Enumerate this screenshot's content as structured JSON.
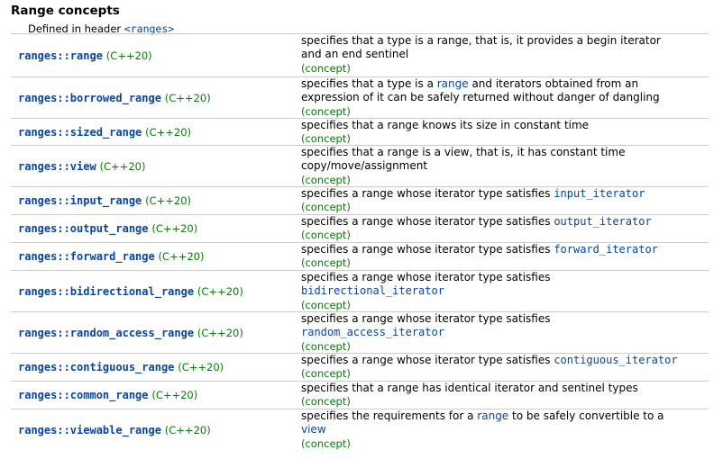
{
  "heading": "Range concepts",
  "defined_prefix": "Defined in header ",
  "header_name": "<ranges>",
  "concept_label": "(concept)",
  "rows": [
    {
      "name": "ranges::range",
      "std": "(C++20)",
      "lines": [
        [
          {
            "t": "text",
            "v": "specifies that a type is a range, that is, it provides a begin iterator"
          }
        ],
        [
          {
            "t": "text",
            "v": "and an end sentinel"
          }
        ]
      ]
    },
    {
      "name": "ranges::borrowed_range",
      "std": "(C++20)",
      "lines": [
        [
          {
            "t": "text",
            "v": "specifies that a type is a "
          },
          {
            "t": "link",
            "v": "range"
          },
          {
            "t": "text",
            "v": " and iterators obtained from an"
          }
        ],
        [
          {
            "t": "text",
            "v": "expression of it can be safely returned without danger of dangling"
          }
        ]
      ]
    },
    {
      "name": "ranges::sized_range",
      "std": "(C++20)",
      "lines": [
        [
          {
            "t": "text",
            "v": "specifies that a range knows its size in constant time"
          }
        ]
      ]
    },
    {
      "name": "ranges::view",
      "std": "(C++20)",
      "lines": [
        [
          {
            "t": "text",
            "v": "specifies that a range is a view, that is, it has constant time"
          }
        ],
        [
          {
            "t": "text",
            "v": "copy/move/assignment"
          }
        ]
      ]
    },
    {
      "name": "ranges::input_range",
      "std": "(C++20)",
      "lines": [
        [
          {
            "t": "text",
            "v": "specifies a range whose iterator type satisfies "
          },
          {
            "t": "code",
            "v": "input_iterator"
          }
        ]
      ]
    },
    {
      "name": "ranges::output_range",
      "std": "(C++20)",
      "lines": [
        [
          {
            "t": "text",
            "v": "specifies a range whose iterator type satisfies "
          },
          {
            "t": "code",
            "v": "output_iterator"
          }
        ]
      ]
    },
    {
      "name": "ranges::forward_range",
      "std": "(C++20)",
      "lines": [
        [
          {
            "t": "text",
            "v": "specifies a range whose iterator type satisfies "
          },
          {
            "t": "code",
            "v": "forward_iterator"
          }
        ]
      ]
    },
    {
      "name": "ranges::bidirectional_range",
      "std": "(C++20)",
      "lines": [
        [
          {
            "t": "text",
            "v": "specifies a range whose iterator type satisfies"
          }
        ],
        [
          {
            "t": "code",
            "v": "bidirectional_iterator"
          }
        ]
      ]
    },
    {
      "name": "ranges::random_access_range",
      "std": "(C++20)",
      "lines": [
        [
          {
            "t": "text",
            "v": "specifies a range whose iterator type satisfies"
          }
        ],
        [
          {
            "t": "code",
            "v": "random_access_iterator"
          }
        ]
      ]
    },
    {
      "name": "ranges::contiguous_range",
      "std": "(C++20)",
      "lines": [
        [
          {
            "t": "text",
            "v": "specifies a range whose iterator type satisfies "
          },
          {
            "t": "code",
            "v": "contiguous_iterator"
          }
        ]
      ]
    },
    {
      "name": "ranges::common_range",
      "std": "(C++20)",
      "lines": [
        [
          {
            "t": "text",
            "v": "specifies that a range has identical iterator and sentinel types"
          }
        ]
      ]
    },
    {
      "name": "ranges::viewable_range",
      "std": "(C++20)",
      "lines": [
        [
          {
            "t": "text",
            "v": "specifies the requirements for a "
          },
          {
            "t": "link",
            "v": "range"
          },
          {
            "t": "text",
            "v": " to be safely convertible to a"
          }
        ],
        [
          {
            "t": "link",
            "v": "view"
          }
        ]
      ]
    }
  ]
}
